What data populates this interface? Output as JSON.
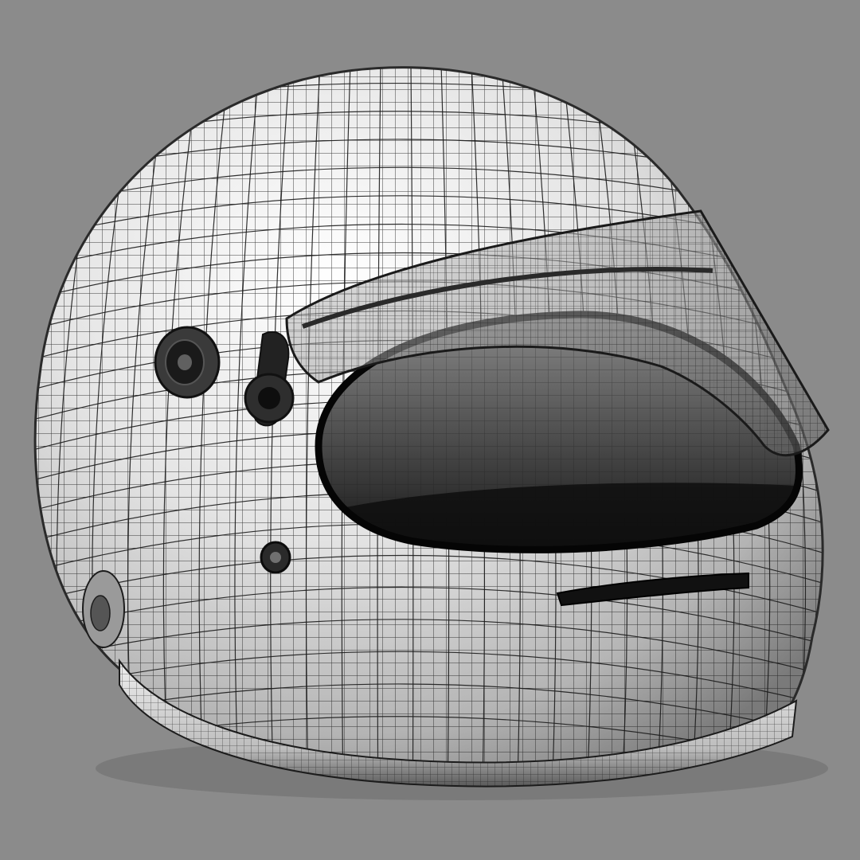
{
  "scene": {
    "subject_icon": "helmet-wireframe-icon",
    "render_style": "wireframe-on-shaded",
    "colors": {
      "background": "#8b8b8b",
      "shell_light": "#f2f2f2",
      "shell_mid": "#c9c9c9",
      "shell_dark": "#6e6e6e",
      "wire": "#1c1c1c",
      "visor": "#7a7a7a",
      "eyeport_dark": "#101010"
    }
  }
}
